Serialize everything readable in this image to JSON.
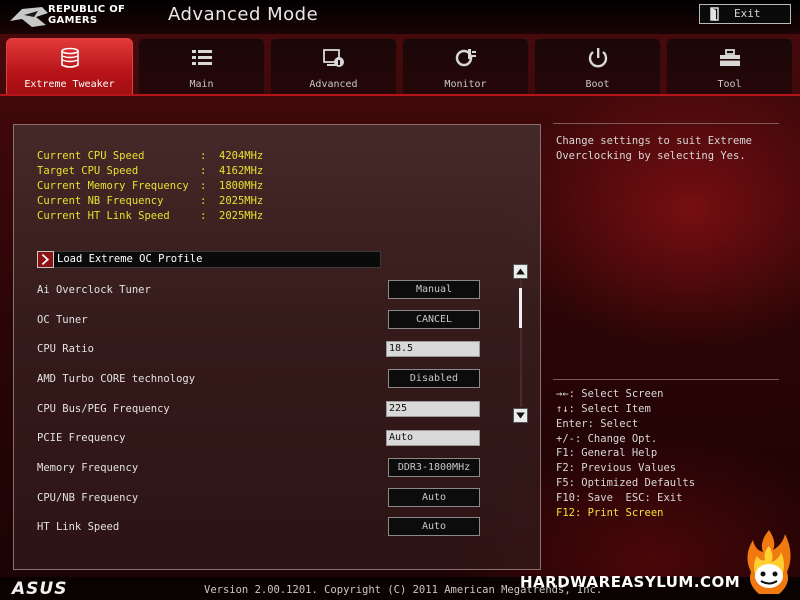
{
  "header": {
    "brand_line1": "REPUBLIC OF",
    "brand_line2": "GAMERS",
    "mode_title": "Advanced Mode",
    "exit_label": "Exit"
  },
  "tabs": [
    {
      "label": "Extreme Tweaker",
      "icon": "tweaker-icon",
      "active": true
    },
    {
      "label": "Main",
      "icon": "list-icon",
      "active": false
    },
    {
      "label": "Advanced",
      "icon": "advanced-icon",
      "active": false
    },
    {
      "label": "Monitor",
      "icon": "monitor-icon",
      "active": false
    },
    {
      "label": "Boot",
      "icon": "power-icon",
      "active": false
    },
    {
      "label": "Tool",
      "icon": "toolbox-icon",
      "active": false
    }
  ],
  "info": [
    {
      "label": "Current CPU Speed",
      "value": "4204MHz"
    },
    {
      "label": "Target CPU Speed",
      "value": "4162MHz"
    },
    {
      "label": "Current Memory Frequency",
      "value": "1800MHz"
    },
    {
      "label": "Current NB Frequency",
      "value": "2025MHz"
    },
    {
      "label": "Current HT Link Speed",
      "value": "2025MHz"
    }
  ],
  "info_separator": ":",
  "profile_item": "Load Extreme OC Profile",
  "settings": [
    {
      "label": "Ai Overclock Tuner",
      "value": "Manual",
      "kind": "button"
    },
    {
      "label": "OC Tuner",
      "value": "CANCEL",
      "kind": "button"
    },
    {
      "label": "CPU Ratio",
      "value": "18.5",
      "kind": "input"
    },
    {
      "label": "AMD Turbo CORE technology",
      "value": "Disabled",
      "kind": "button"
    },
    {
      "label": "CPU Bus/PEG Frequency",
      "value": "225",
      "kind": "input"
    },
    {
      "label": "PCIE Frequency",
      "value": "Auto",
      "kind": "input"
    },
    {
      "label": "Memory Frequency",
      "value": "DDR3-1800MHz",
      "kind": "button"
    },
    {
      "label": "CPU/NB Frequency",
      "value": "Auto",
      "kind": "button"
    },
    {
      "label": "HT Link Speed",
      "value": "Auto",
      "kind": "button"
    }
  ],
  "help_text": "Change settings to suit Extreme Overclocking by selecting Yes.",
  "key_help": [
    "→←: Select Screen",
    "↑↓: Select Item",
    "Enter: Select",
    "+/-: Change Opt.",
    "F1: General Help",
    "F2: Previous Values",
    "F5: Optimized Defaults",
    "F10: Save  ESC: Exit",
    "F12: Print Screen"
  ],
  "footer": {
    "asus": "ASUS",
    "version": "Version 2.00.1201. Copyright (C) 2011 American Megatrends, Inc.",
    "watermark": "HARDWAREASYLUM.COM"
  },
  "colors": {
    "accent_red": "#b81418",
    "info_yellow": "#e8e030",
    "highlight_yellow": "#f2e13a"
  }
}
